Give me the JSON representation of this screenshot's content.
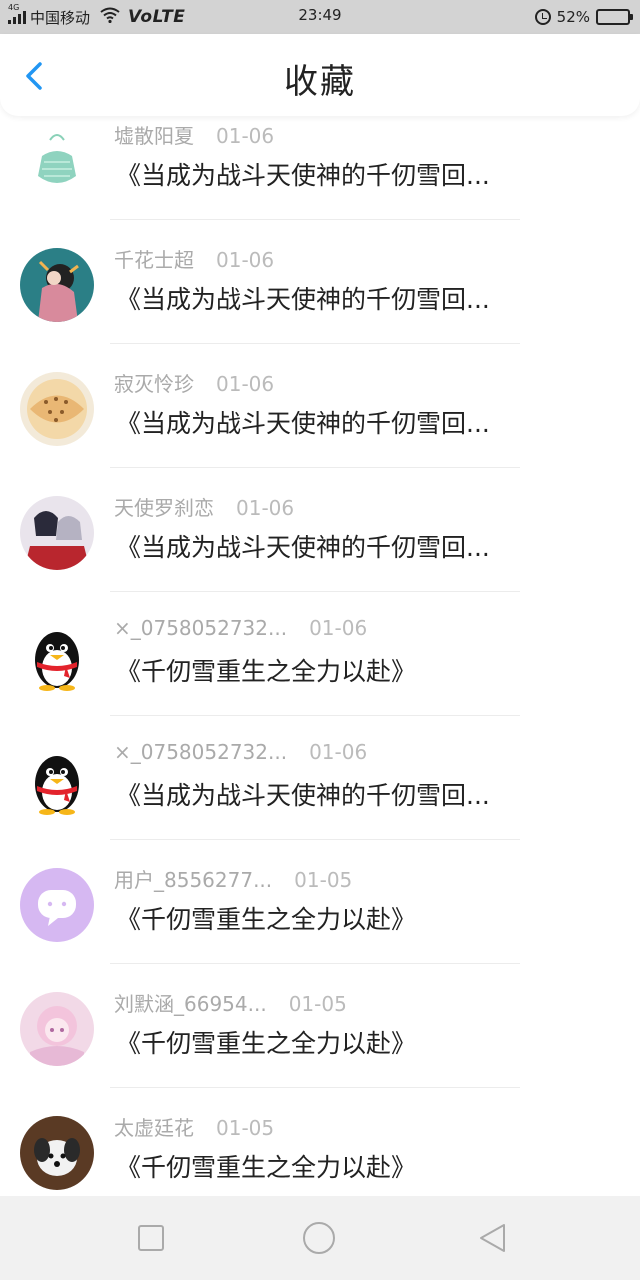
{
  "status_bar": {
    "net_tag": "4G",
    "carrier": "中国移动",
    "volte": "VoLTE",
    "time": "23:49",
    "battery_percent_text": "52%",
    "battery_level": 0.52
  },
  "header": {
    "title": "收藏"
  },
  "favorites": [
    {
      "name": "墟散阳夏",
      "date": "01-06",
      "content": "《当成为战斗天使神的千仞雪回...",
      "avatar": "green-bag-avatar"
    },
    {
      "name": "千花士超",
      "date": "01-06",
      "content": "《当成为战斗天使神的千仞雪回...",
      "avatar": "anime-girl-avatar"
    },
    {
      "name": "寂灭怜珍",
      "date": "01-06",
      "content": "《当成为战斗天使神的千仞雪回...",
      "avatar": "seashell-avatar"
    },
    {
      "name": "天使罗刹恋",
      "date": "01-06",
      "content": "《当成为战斗天使神的千仞雪回...",
      "avatar": "anime-couple-avatar"
    },
    {
      "name": "×_0758052732...",
      "date": "01-06",
      "content": "《千仞雪重生之全力以赴》",
      "avatar": "qq-penguin-avatar"
    },
    {
      "name": "×_0758052732...",
      "date": "01-06",
      "content": "《当成为战斗天使神的千仞雪回...",
      "avatar": "qq-penguin-avatar"
    },
    {
      "name": "用户_8556277...",
      "date": "01-05",
      "content": "《千仞雪重生之全力以赴》",
      "avatar": "chat-bubble-avatar"
    },
    {
      "name": "刘默涵_66954...",
      "date": "01-05",
      "content": "《千仞雪重生之全力以赴》",
      "avatar": "pink-anime-avatar"
    },
    {
      "name": "太虚廷花",
      "date": "01-05",
      "content": "《千仞雪重生之全力以赴》",
      "avatar": "puppy-avatar"
    }
  ],
  "colors": {
    "accent": "#2196f3",
    "status_bar_bg": "#d3d3d3",
    "nav_bar_bg": "#f1f1f1",
    "meta_text": "#aaaaaa",
    "battery_fill": "#3ad14b"
  }
}
